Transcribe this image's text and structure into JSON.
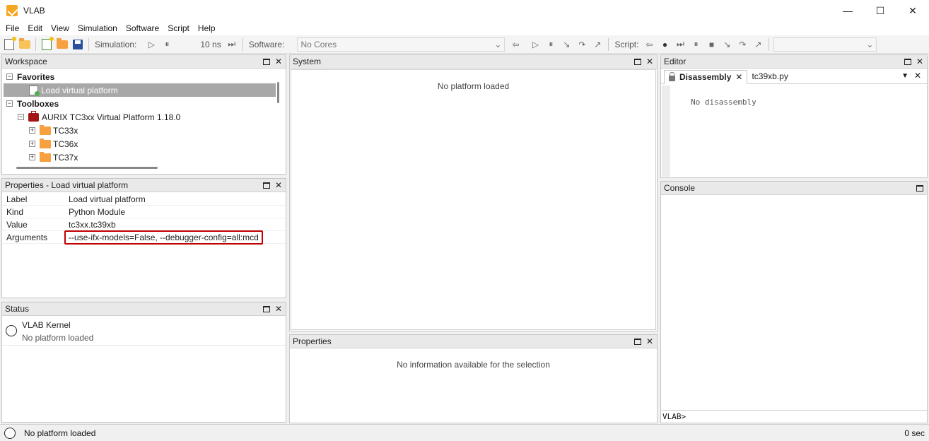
{
  "window": {
    "title": "VLAB",
    "minimize": "—",
    "maximize": "☐",
    "close": "✕"
  },
  "menu": [
    "File",
    "Edit",
    "View",
    "Simulation",
    "Software",
    "Script",
    "Help"
  ],
  "toolbar": {
    "simulation_label": "Simulation:",
    "time_value": "10 ns",
    "software_label": "Software:",
    "cores_value": "No Cores",
    "script_label": "Script:",
    "script_value": ""
  },
  "workspace": {
    "title": "Workspace",
    "favorites_label": "Favorites",
    "favorite_item": "Load virtual platform",
    "toolboxes_label": "Toolboxes",
    "toolbox_item": "AURIX TC3xx Virtual Platform 1.18.0",
    "folders": [
      "TC33x",
      "TC36x",
      "TC37x"
    ]
  },
  "properties_panel": {
    "title": "Properties - Load virtual platform",
    "rows": [
      {
        "key": "Label",
        "value": "Load virtual platform"
      },
      {
        "key": "Kind",
        "value": "Python Module"
      },
      {
        "key": "Value",
        "value": "tc3xx.tc39xb"
      },
      {
        "key": "Arguments",
        "value": "--use-ifx-models=False, --debugger-config=all:mcd"
      }
    ]
  },
  "status_panel": {
    "title": "Status",
    "item_title": "VLAB Kernel",
    "item_subtitle": "No platform loaded"
  },
  "system_panel": {
    "title": "System",
    "message": "No platform loaded"
  },
  "properties_bottom": {
    "title": "Properties",
    "message": "No information available for the selection"
  },
  "editor": {
    "title": "Editor",
    "tabs": [
      {
        "label": "Disassembly"
      },
      {
        "label": "tc39xb.py"
      }
    ],
    "message": "No disassembly"
  },
  "console": {
    "title": "Console",
    "prompt": "VLAB>"
  },
  "statusbar": {
    "message": "No platform loaded",
    "time": "0 sec"
  }
}
